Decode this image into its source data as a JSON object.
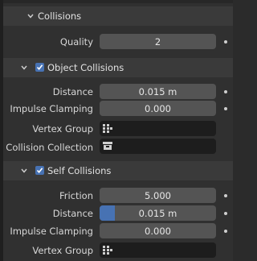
{
  "collisions": {
    "title": "Collisions",
    "quality_label": "Quality",
    "quality_value": "2"
  },
  "object_collisions": {
    "title": "Object Collisions",
    "enabled": true,
    "distance_label": "Distance",
    "distance_value": "0.015 m",
    "impulse_label": "Impulse Clamping",
    "impulse_value": "0.000",
    "vertex_group_label": "Vertex Group",
    "vertex_group_value": "",
    "collection_label": "Collision Collection",
    "collection_value": ""
  },
  "self_collisions": {
    "title": "Self Collisions",
    "enabled": true,
    "friction_label": "Friction",
    "friction_value": "5.000",
    "distance_label": "Distance",
    "distance_value": "0.015 m",
    "distance_fill": 0.13,
    "impulse_label": "Impulse Clamping",
    "impulse_value": "0.000",
    "vertex_group_label": "Vertex Group",
    "vertex_group_value": ""
  },
  "colors": {
    "accent": "#4772b3",
    "field": "#545454",
    "field_dark": "#1d1d1d",
    "header": "#3a3a3a"
  },
  "icons": [
    "chevron-down-icon",
    "checkbox-icon",
    "vertex-group-icon",
    "collection-icon",
    "animate-dot-icon"
  ]
}
